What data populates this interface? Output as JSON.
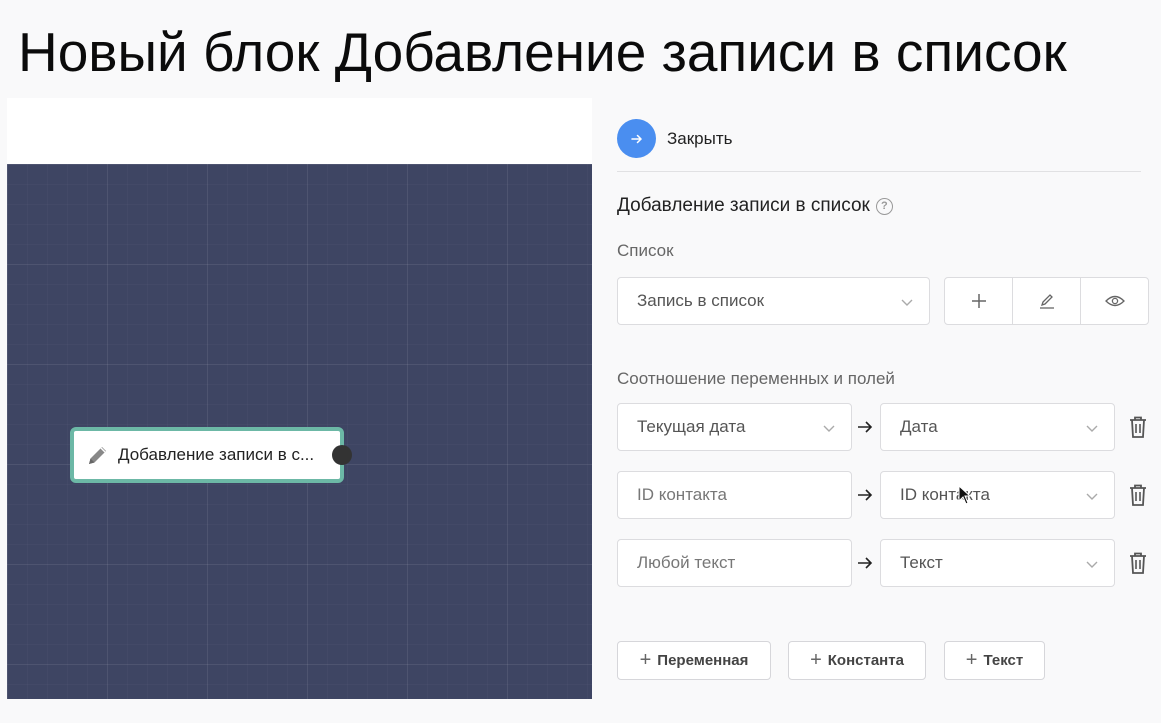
{
  "slide": {
    "title": "Новый блок Добавление записи в список"
  },
  "canvas": {
    "node": {
      "label": "Добавление записи в с..."
    }
  },
  "panel": {
    "close_label": "Закрыть",
    "title": "Добавление записи в список",
    "help_symbol": "?",
    "list_label": "Список",
    "list_select": {
      "value": "Запись в список"
    },
    "list_actions": [
      "add-icon",
      "edit-icon",
      "view-icon"
    ],
    "mapping_label": "Соотношение переменных и полей",
    "mappings": [
      {
        "source": "Текущая дата",
        "source_type": "select",
        "target": "Дата"
      },
      {
        "source": "ID контакта",
        "source_type": "input",
        "target": "ID контакта"
      },
      {
        "source": "Любой текст",
        "source_type": "input",
        "target": "Текст"
      }
    ],
    "add_buttons": [
      "Переменная",
      "Константа",
      "Текст"
    ],
    "plus_symbol": "+"
  },
  "colors": {
    "canvas_bg": "#3e4563",
    "node_border": "#6cb8a6",
    "accent": "#4a8ef0"
  }
}
